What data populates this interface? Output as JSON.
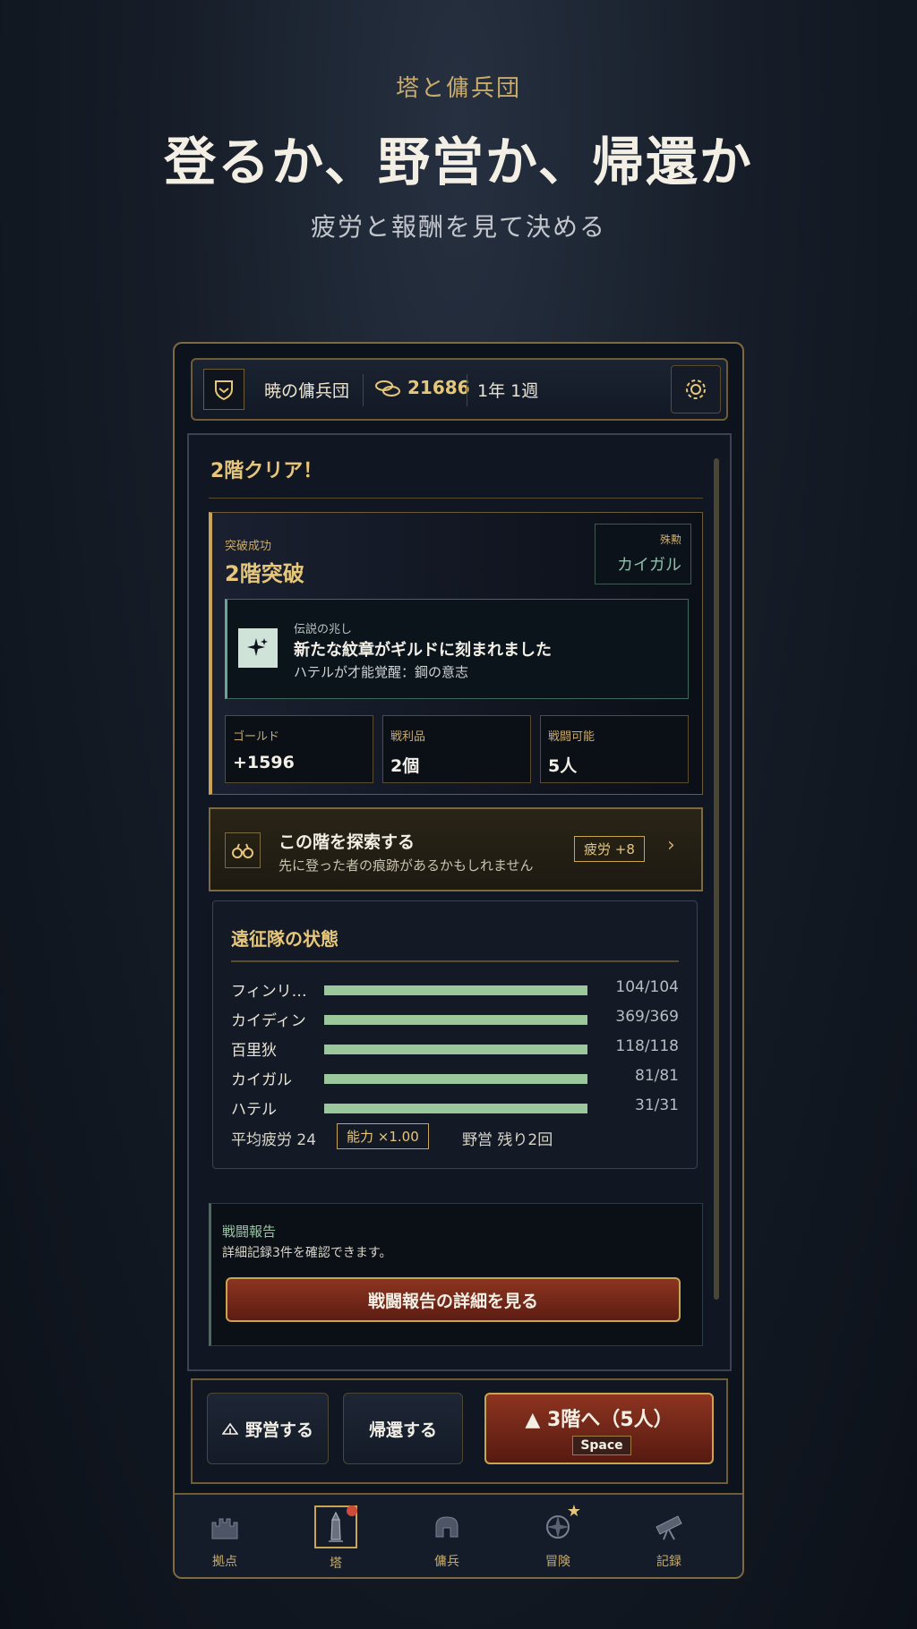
{
  "promo": {
    "subtitle": "塔と傭兵団",
    "title": "登るか、野営か、帰還か",
    "caption": "疲労と報酬を見て決める"
  },
  "header": {
    "guild_name": "暁の傭兵団",
    "gold": "21686",
    "date": "1年 1週"
  },
  "result": {
    "title": "2階クリア！",
    "breach_label": "突破成功",
    "breach_title": "2階突破",
    "mvp_label": "殊勲",
    "mvp_name": "カイガル",
    "omen_label": "伝説の兆し",
    "omen_title": "新たな紋章がギルドに刻まれました",
    "omen_detail": "ハテルが才能覚醒：鋼の意志",
    "stats": [
      {
        "label": "ゴールド",
        "value": "+1596"
      },
      {
        "label": "戦利品",
        "value": "2個"
      },
      {
        "label": "戦闘可能",
        "value": "5人"
      }
    ]
  },
  "explore": {
    "title": "この階を探索する",
    "subtitle": "先に登った者の痕跡があるかもしれません",
    "fatigue": "疲労 +8",
    "chevron": "›"
  },
  "party": {
    "title": "遠征隊の状態",
    "members": [
      {
        "name": "フィンリ…",
        "hp": "104/104",
        "hp_ratio": 1.0
      },
      {
        "name": "カイディン",
        "hp": "369/369",
        "hp_ratio": 1.0
      },
      {
        "name": "百里狄",
        "hp": "118/118",
        "hp_ratio": 1.0
      },
      {
        "name": "カイガル",
        "hp": "81/81",
        "hp_ratio": 1.0
      },
      {
        "name": "ハテル",
        "hp": "31/31",
        "hp_ratio": 1.0
      }
    ],
    "avg_fatigue": "平均疲労 24",
    "ability": "能力 ×1.00",
    "camp_left": "野営 残り2回"
  },
  "report": {
    "title": "戦闘報告",
    "description": "詳細記録3件を確認できます。",
    "button": "戦闘報告の詳細を見る"
  },
  "actions": {
    "camp": "野営する",
    "return": "帰還する",
    "ascend": "▲ 3階へ（5人）",
    "ascend_key": "Space"
  },
  "nav": {
    "items": [
      {
        "label": "拠点",
        "icon": "castle-icon"
      },
      {
        "label": "塔",
        "icon": "tower-icon"
      },
      {
        "label": "傭兵",
        "icon": "helmet-icon"
      },
      {
        "label": "冒険",
        "icon": "compass-icon"
      },
      {
        "label": "記録",
        "icon": "telescope-icon"
      }
    ]
  },
  "colors": {
    "accent_gold": "#c9a452",
    "primary_red": "#8d3420",
    "hp_green": "#9bc79c",
    "background": "#0d131c"
  }
}
